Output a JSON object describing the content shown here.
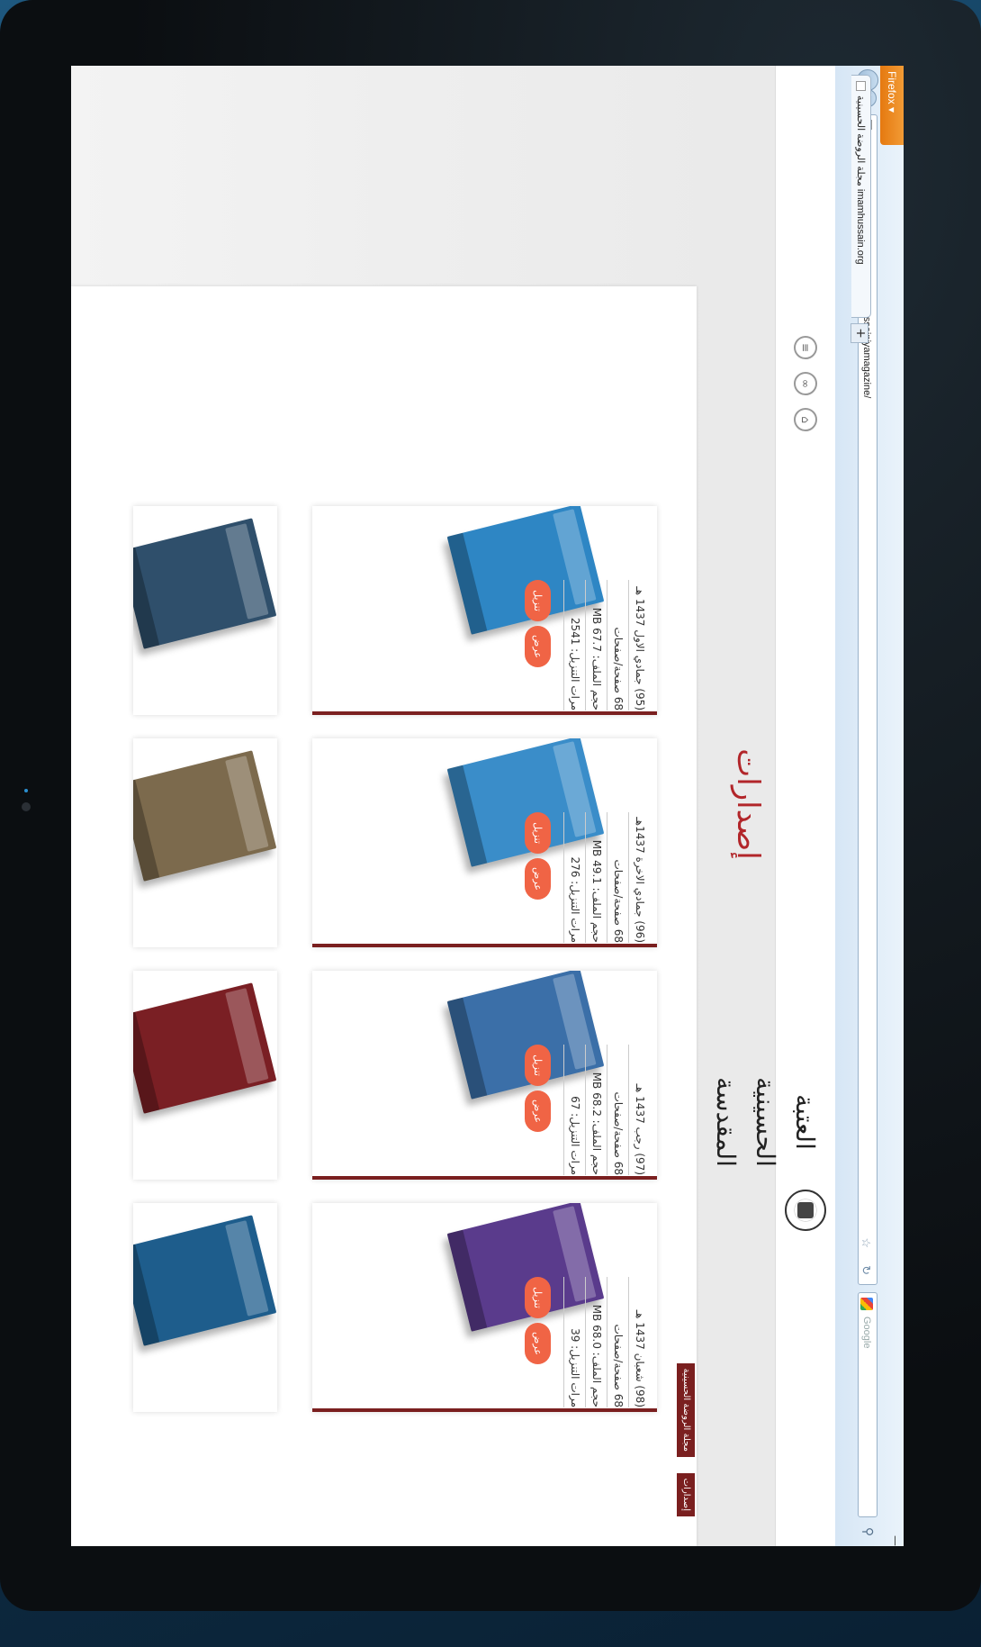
{
  "browser": {
    "menu_label": "Firefox ▾",
    "tab_title": "مجلة الروضة الحسينية imamhussain.org",
    "new_tab": "+",
    "url": "imamhussain.org/arabic/publications/alhusseiniyamagazine/",
    "search_placeholder": "Google",
    "search_icon": "search-icon",
    "close_icon": "—"
  },
  "site": {
    "logo_text": "العتبة الحسينية المقدسة",
    "header_icons": [
      "menu-icon",
      "link-icon",
      "home-icon"
    ]
  },
  "page": {
    "title": "إصدارات",
    "breadcrumb": [
      "إصدارات",
      "مجلة الروضة الحسينية"
    ]
  },
  "issues": [
    {
      "issue": "(95) جمادي الاول 1437 هـ",
      "pages": "68 صفحة/صفحات",
      "size": "حجم الملف: 67.7 MB",
      "downloads": "مرات التنزيل: 2541",
      "view": "عرض",
      "download": "تنزيل",
      "cover_color": "#2e86c4"
    },
    {
      "issue": "(96) جمادي الاخرة 1437هـ",
      "pages": "68 صفحة/صفحات",
      "size": "حجم الملف: 49.1 MB",
      "downloads": "مرات التنزيل: 276",
      "view": "عرض",
      "download": "تنزيل",
      "cover_color": "#3a8dc9"
    },
    {
      "issue": "(97) رجب 1437 هـ",
      "pages": "68 صفحة/صفحات",
      "size": "حجم الملف: 68.2 MB",
      "downloads": "مرات التنزيل: 67",
      "view": "عرض",
      "download": "تنزيل",
      "cover_color": "#3b6fa8"
    },
    {
      "issue": "(98) شعبان 1437 هـ",
      "pages": "68 صفحة/صفحات",
      "size": "حجم الملف: 68.0 MB",
      "downloads": "مرات التنزيل: 39",
      "view": "عرض",
      "download": "تنزيل",
      "cover_color": "#5a3b8c"
    }
  ],
  "more_covers": [
    "#2f4f6b",
    "#7c6a4d",
    "#7a1f24",
    "#1e5d8c"
  ]
}
